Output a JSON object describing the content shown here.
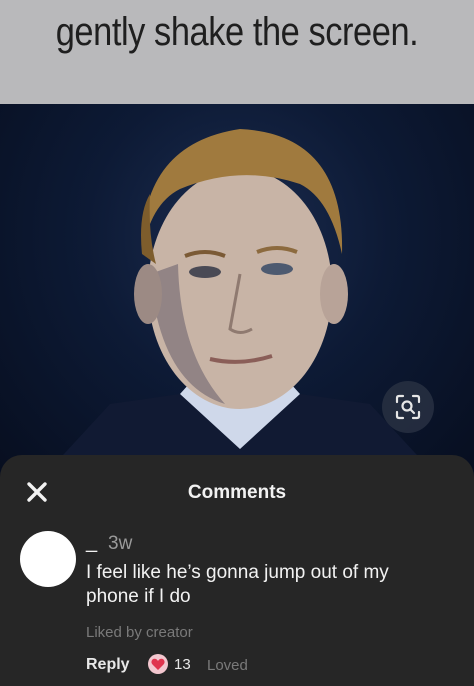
{
  "meme": {
    "caption": "gently shake the screen."
  },
  "icons": {
    "lens": "visual-search-icon",
    "close": "close-icon",
    "reaction": "heart-icon"
  },
  "comments_sheet": {
    "title": "Comments",
    "comment": {
      "username": "_",
      "timestamp": "3w",
      "text": "I feel like he’s gonna jump out of my phone if I do",
      "liked_by": "Liked by creator",
      "reply_label": "Reply",
      "reaction_count": "13",
      "loved_label": "Loved"
    }
  },
  "colors": {
    "sheet_background": "#262626",
    "heart": "#e0344e",
    "caption_band": "#b9b9bb"
  }
}
